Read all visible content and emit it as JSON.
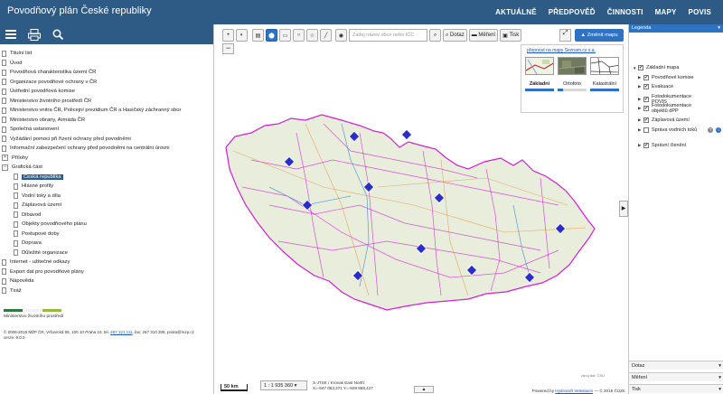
{
  "app": {
    "title": "Povodňový plán České republiky"
  },
  "topnav": [
    "AKTUÁLNĚ",
    "PŘEDPOVĚĎ",
    "ČINNOSTI",
    "MAPY",
    "POVIS"
  ],
  "tree": {
    "items": [
      {
        "label": "Titulní list",
        "kind": "doc"
      },
      {
        "label": "Úvod",
        "kind": "doc"
      },
      {
        "label": "Povodňová charakteristika území ČR",
        "kind": "doc"
      },
      {
        "label": "Organizace povodňové ochrany v ČR",
        "kind": "doc"
      },
      {
        "label": "Ústřední povodňová komise",
        "kind": "doc"
      },
      {
        "label": "Ministerstvo životního prostředí ČR",
        "kind": "doc"
      },
      {
        "label": "Ministerstvo vnitra ČR, Policejní prezidium ČR a Hasičský záchranný sbor",
        "kind": "doc"
      },
      {
        "label": "Ministerstvo obrany, Armáda ČR",
        "kind": "doc"
      },
      {
        "label": "Společná ustanovení",
        "kind": "doc"
      },
      {
        "label": "Vyžádání pomoci při řízení ochrany před povodněmi",
        "kind": "doc"
      },
      {
        "label": "Informační zabezpečení ochrany před povodněmi na centrální úrovni",
        "kind": "doc"
      },
      {
        "label": "Přílohy",
        "kind": "folder",
        "sign": "+"
      },
      {
        "label": "Grafická část",
        "kind": "folder",
        "sign": "−"
      },
      {
        "label": "Česká republika",
        "kind": "sub",
        "selected": true
      },
      {
        "label": "Hlásné profily",
        "kind": "sub"
      },
      {
        "label": "Vodní toky a díla",
        "kind": "sub"
      },
      {
        "label": "Záplavová území",
        "kind": "sub"
      },
      {
        "label": "Dibavod",
        "kind": "sub"
      },
      {
        "label": "Objekty povodňového plánu",
        "kind": "sub"
      },
      {
        "label": "Postupové doby",
        "kind": "sub"
      },
      {
        "label": "Doprava",
        "kind": "sub"
      },
      {
        "label": "Důležité organizace",
        "kind": "sub"
      },
      {
        "label": "Internet - užitečné odkazy",
        "kind": "doc"
      },
      {
        "label": "Export dat pro povodňové plány",
        "kind": "doc"
      },
      {
        "label": "Nápověda",
        "kind": "doc"
      },
      {
        "label": "Tiráž",
        "kind": "doc"
      }
    ]
  },
  "footer": {
    "ministry": "Ministerstvo životního prostředí",
    "copy_line1": "© 2006-2018 MŽP ČR, Vršovická 65, 100 10 Praha 10, tel.",
    "phone": "267 121 111",
    "copy_line1b": ", fax: 267 310 308, posta@mzp.cz",
    "version": "verze: 9.0.0",
    "colors": [
      "#2e7a38",
      "#f2f2f2",
      "#8fbd3a"
    ]
  },
  "map": {
    "search_placeholder": "Zadej název obce nebo ICC",
    "buttons": {
      "dotaz": "Dotaz",
      "mereni": "Měření",
      "tisk": "Tisk"
    },
    "change_map": "Změnit mapu",
    "switch_link": "přepnout na mapy Seznam.cz s.a.",
    "basemaps": [
      {
        "label": "Základní",
        "level": 1.0
      },
      {
        "label": "Ortofoto",
        "level": 0.2
      },
      {
        "label": "Katastrální",
        "level": 1.0
      }
    ],
    "scale_bar": "50 km",
    "scale_select": "1 : 1 935 360 ▾",
    "coords_line1": "S-JTSK / Krovak East North:",
    "coords_line2": "X=-947 063,371 Y=-929 868,427",
    "powered_prefix": "Powered by",
    "powered_link": "Hydrosoft Veleslavín",
    "powered_suffix": "— © 2018 ČÚZK",
    "small_tag": "zdroj dat: ČSÚ",
    "accent": "#2e72c4",
    "border_color": "#d21fd2",
    "marker_color": "#2c2cc8"
  },
  "legend": {
    "title": "Legenda",
    "items": [
      {
        "label": "Základní mapa",
        "checked": true,
        "level": 0,
        "tri": "▼"
      },
      {
        "label": "Povodňové komise",
        "checked": true,
        "level": 1,
        "tri": "▶"
      },
      {
        "label": "Evakuace",
        "checked": true,
        "level": 1,
        "tri": "▶"
      },
      {
        "label": "Fotodokumentace POVIS",
        "checked": true,
        "level": 1,
        "tri": "▶"
      },
      {
        "label": "Fotodokumentace objektů dPP",
        "checked": true,
        "level": 1,
        "tri": "▶"
      },
      {
        "label": "Záplavová území",
        "checked": true,
        "level": 1,
        "tri": "▶"
      },
      {
        "label": "Správa vodních toků",
        "checked": false,
        "level": 1,
        "tri": "▶"
      },
      {
        "label": "Správní členění",
        "checked": true,
        "level": 1,
        "tri": "▶"
      }
    ],
    "bottom": [
      "Dotaz",
      "Měření",
      "Tisk"
    ]
  }
}
